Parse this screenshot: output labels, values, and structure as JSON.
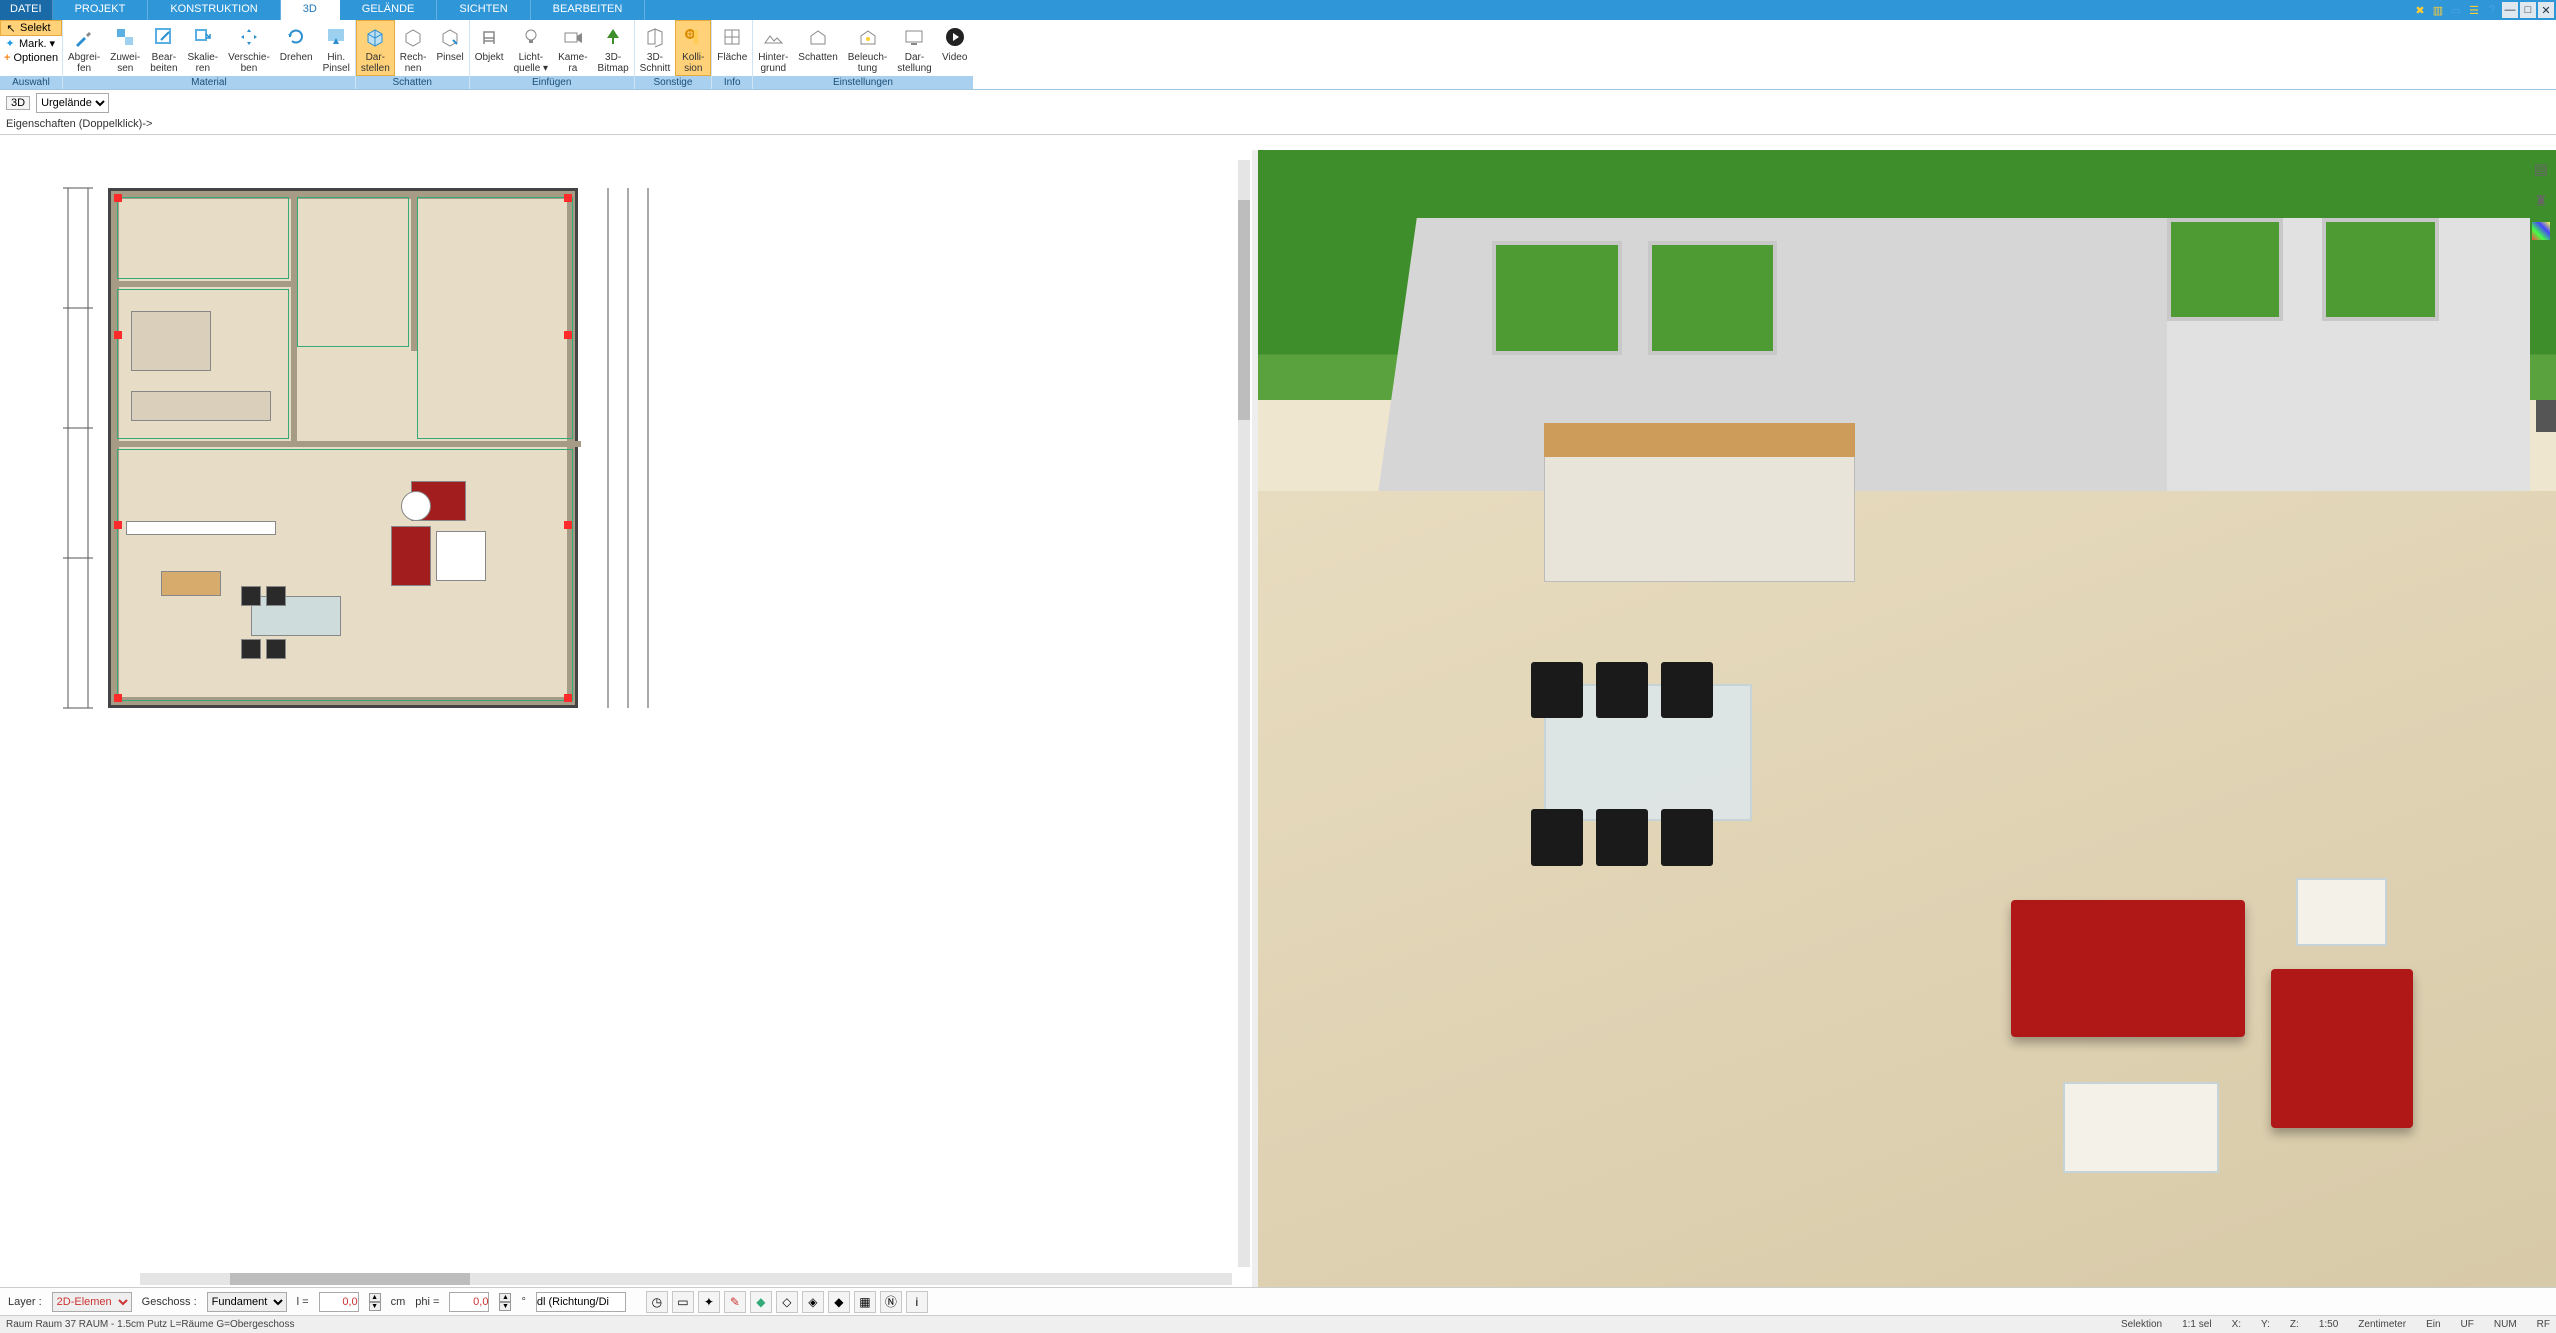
{
  "tabs": {
    "datei": "DATEI",
    "projekt": "PROJEKT",
    "konstruktion": "KONSTRUKTION",
    "d3": "3D",
    "gelaende": "GELÄNDE",
    "sichten": "SICHTEN",
    "bearbeiten": "BEARBEITEN"
  },
  "side": {
    "selekt": "Selekt",
    "mark": "Mark.",
    "optionen": "Optionen",
    "group": "Auswahl"
  },
  "ribbon": {
    "material": {
      "label": "Material",
      "abgreifen1": "Abgrei-",
      "abgreifen2": "fen",
      "zuweisen1": "Zuwei-",
      "zuweisen2": "sen",
      "bearbeiten1": "Bear-",
      "bearbeiten2": "beiten",
      "skalieren1": "Skalie-",
      "skalieren2": "ren",
      "verschieben1": "Verschie-",
      "verschieben2": "ben",
      "drehen": "Drehen",
      "hinpinsel1": "Hin.",
      "hinpinsel2": "Pinsel"
    },
    "schatten": {
      "label": "Schatten",
      "darstellen1": "Dar-",
      "darstellen2": "stellen",
      "rechnen1": "Rech-",
      "rechnen2": "nen",
      "pinsel": "Pinsel"
    },
    "einfuegen": {
      "label": "Einfügen",
      "objekt": "Objekt",
      "licht1": "Licht-",
      "licht2": "quelle ▾",
      "kamera1": "Kame-",
      "kamera2": "ra",
      "bitmap1": "3D-",
      "bitmap2": "Bitmap"
    },
    "sonstige": {
      "label": "Sonstige",
      "schnitt1": "3D-",
      "schnitt2": "Schnitt",
      "kollision1": "Kolli-",
      "kollision2": "sion"
    },
    "info": {
      "label": "Info",
      "flaeche": "Fläche"
    },
    "einstellungen": {
      "label": "Einstellungen",
      "hintergrund1": "Hinter-",
      "hintergrund2": "grund",
      "schatten": "Schatten",
      "beleuchtung1": "Beleuch-",
      "beleuchtung2": "tung",
      "darstellung1": "Dar-",
      "darstellung2": "stellung",
      "video": "Video"
    }
  },
  "subbar": {
    "badge": "3D",
    "combo": "Urgelände",
    "props": "Eigenschaften (Doppelklick)->"
  },
  "bottom": {
    "layer_label": "Layer :",
    "layer_value": "2D-Elemen",
    "geschoss_label": "Geschoss :",
    "geschoss_value": "Fundament",
    "l_label": "l =",
    "l_value": "0,0",
    "cm": "cm",
    "phi_label": "phi =",
    "phi_value": "0,0",
    "deg": "°",
    "dl": "dl (Richtung/Di"
  },
  "status": {
    "left": "Raum Raum 37 RAUM  -  1.5cm Putz L=Räume G=Obergeschoss",
    "selektion": "Selektion",
    "sel": "1:1 sel",
    "x": "X:",
    "y": "Y:",
    "z": "Z:",
    "scale": "1:50",
    "unit": "Zentimeter",
    "ein": "Ein",
    "uf": "UF",
    "num": "NUM",
    "rf": "RF"
  }
}
